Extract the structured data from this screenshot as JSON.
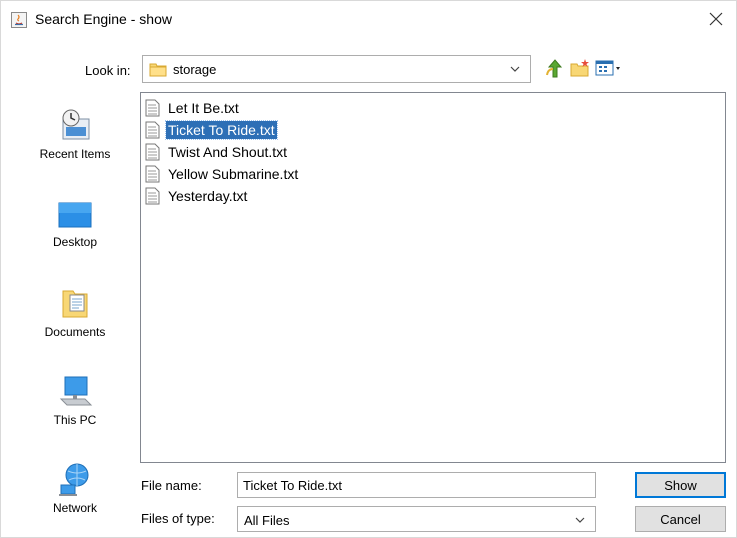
{
  "window": {
    "title": "Search Engine - show"
  },
  "lookin": {
    "label": "Look in:",
    "value": "storage"
  },
  "places": [
    {
      "label": "Recent Items"
    },
    {
      "label": "Desktop"
    },
    {
      "label": "Documents"
    },
    {
      "label": "This PC"
    },
    {
      "label": "Network"
    }
  ],
  "files": [
    {
      "name": "Let It Be.txt"
    },
    {
      "name": "Ticket To Ride.txt"
    },
    {
      "name": "Twist And Shout.txt"
    },
    {
      "name": "Yellow Submarine.txt"
    },
    {
      "name": "Yesterday.txt"
    }
  ],
  "selected_file": "Ticket To Ride.txt",
  "filename": {
    "label": "File name:",
    "value": "Ticket To Ride.txt"
  },
  "filetype": {
    "label": "Files of type:",
    "value": "All Files"
  },
  "buttons": {
    "show": "Show",
    "cancel": "Cancel"
  },
  "colors": {
    "selection": "#2d6fb6",
    "default_button_border": "#0078d7"
  }
}
